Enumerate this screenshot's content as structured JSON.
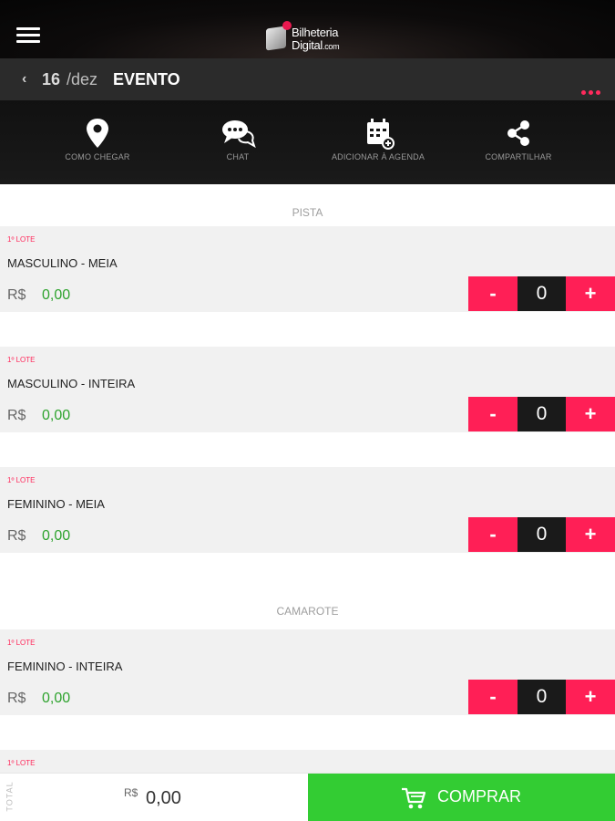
{
  "header": {
    "logo_text_line1": "Bilheteria",
    "logo_text_line2": "Digital",
    "logo_text_suffix": ".com"
  },
  "subheader": {
    "back_icon": "‹",
    "date_day": "16",
    "date_month": "/dez",
    "title": "EVENTO"
  },
  "actions": [
    {
      "label": "COMO CHEGAR",
      "icon": "map-pin-icon"
    },
    {
      "label": "CHAT",
      "icon": "chat-icon"
    },
    {
      "label": "ADICIONAR À AGENDA",
      "icon": "calendar-add-icon"
    },
    {
      "label": "COMPARTILHAR",
      "icon": "share-icon"
    }
  ],
  "sections": [
    {
      "title": "PISTA"
    },
    {
      "title": "CAMAROTE"
    }
  ],
  "tickets": [
    {
      "lote": "1º LOTE",
      "name": "MASCULINO - MEIA",
      "currency": "R$",
      "price": "0,00",
      "qty": "0",
      "minus": "-",
      "plus": "+"
    },
    {
      "lote": "1º LOTE",
      "name": "MASCULINO - INTEIRA",
      "currency": "R$",
      "price": "0,00",
      "qty": "0",
      "minus": "-",
      "plus": "+"
    },
    {
      "lote": "1º LOTE",
      "name": "FEMININO - MEIA",
      "currency": "R$",
      "price": "0,00",
      "qty": "0",
      "minus": "-",
      "plus": "+"
    },
    {
      "lote": "1º LOTE",
      "name": "FEMININO - INTEIRA",
      "currency": "R$",
      "price": "0,00",
      "qty": "0",
      "minus": "-",
      "plus": "+"
    },
    {
      "lote": "1º LOTE"
    }
  ],
  "footer": {
    "total_label": "TOTAL",
    "total_currency": "R$",
    "total_value": "0,00",
    "buy_label": "COMPRAR"
  },
  "colors": {
    "accent": "#ff1f56",
    "price_green": "#2ea32e",
    "buy_green": "#33cc33"
  }
}
